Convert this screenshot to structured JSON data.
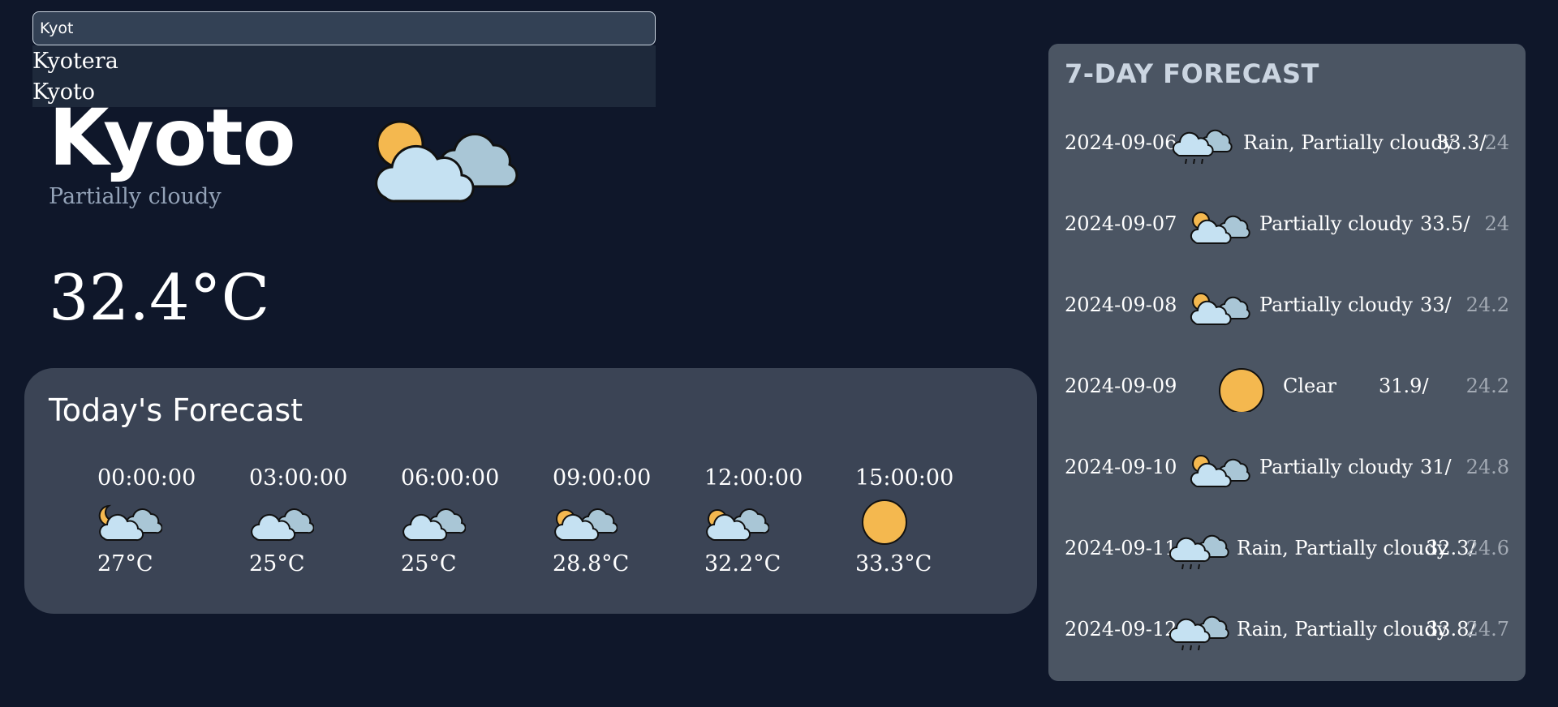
{
  "search": {
    "value": "Kyot",
    "suggestions": [
      "Kyotera",
      "Kyoto"
    ]
  },
  "current": {
    "city": "Kyoto",
    "condition": "Partially cloudy",
    "temperature": "32.4°C",
    "icon": "partly-cloudy-icon"
  },
  "today": {
    "title": "Today's Forecast",
    "hours": [
      {
        "time": "00:00:00",
        "temp": "27°C",
        "icon": "partly-cloudy-night-icon"
      },
      {
        "time": "03:00:00",
        "temp": "25°C",
        "icon": "cloudy-icon"
      },
      {
        "time": "06:00:00",
        "temp": "25°C",
        "icon": "cloudy-icon"
      },
      {
        "time": "09:00:00",
        "temp": "28.8°C",
        "icon": "partly-cloudy-icon"
      },
      {
        "time": "12:00:00",
        "temp": "32.2°C",
        "icon": "partly-cloudy-icon"
      },
      {
        "time": "15:00:00",
        "temp": "33.3°C",
        "icon": "sun-icon"
      }
    ]
  },
  "week": {
    "title": "7-DAY FORECAST",
    "days": [
      {
        "date": "2024-09-06",
        "condition": "Rain, Partially cloudy",
        "max": "33.3/",
        "min": "24",
        "icon": "rain-icon"
      },
      {
        "date": "2024-09-07",
        "condition": "Partially cloudy",
        "max": "33.5/",
        "min": "24",
        "icon": "partly-cloudy-icon"
      },
      {
        "date": "2024-09-08",
        "condition": "Partially cloudy",
        "max": "33/",
        "min": "24.2",
        "icon": "partly-cloudy-icon"
      },
      {
        "date": "2024-09-09",
        "condition": "Clear",
        "max": "31.9/",
        "min": "24.2",
        "icon": "sun-icon"
      },
      {
        "date": "2024-09-10",
        "condition": "Partially cloudy",
        "max": "31/",
        "min": "24.8",
        "icon": "partly-cloudy-icon"
      },
      {
        "date": "2024-09-11",
        "condition": "Rain, Partially cloudy",
        "max": "32.3/",
        "min": "24.6",
        "icon": "rain-icon"
      },
      {
        "date": "2024-09-12",
        "condition": "Rain, Partially cloudy",
        "max": "33.8/",
        "min": "24.7",
        "icon": "rain-icon"
      }
    ]
  },
  "colors": {
    "background": "#0f172a",
    "panel": "#3b4455",
    "week_panel": "#4b5563",
    "sun": "#f4b84f",
    "cloud_front": "#c5e1f2",
    "cloud_back": "#a9c6d6"
  }
}
